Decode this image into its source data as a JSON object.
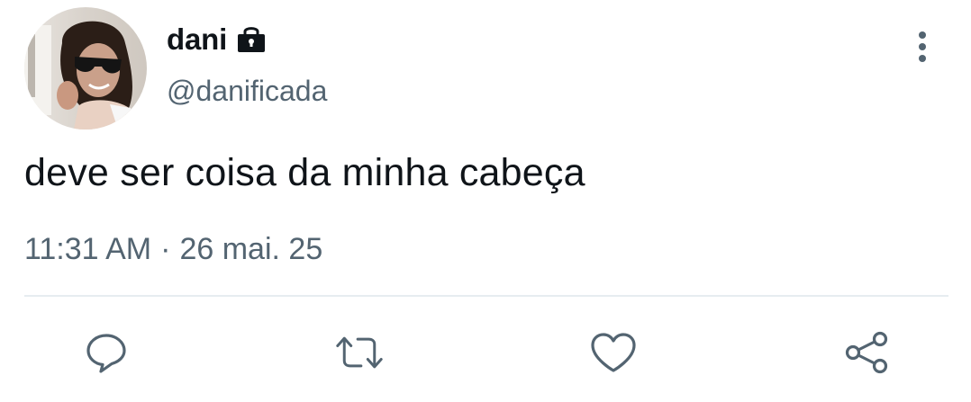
{
  "user": {
    "display_name": "dani",
    "handle": "@danificada",
    "avatar": "avatar-photo",
    "lock_icon": "lock-icon"
  },
  "tweet": {
    "text": "deve ser coisa da minha cabeça",
    "time": "11:31 AM",
    "separator": "·",
    "date": "26 mai. 25"
  },
  "actions": [
    {
      "name": "reply",
      "icon": "reply-icon"
    },
    {
      "name": "retweet",
      "icon": "retweet-icon"
    },
    {
      "name": "like",
      "icon": "heart-icon"
    },
    {
      "name": "share",
      "icon": "share-icon"
    }
  ],
  "menu": {
    "icon": "more-vertical-icon"
  },
  "colors": {
    "primary_text": "#0f1419",
    "secondary_text": "#536471",
    "icon": "#536471",
    "divider": "#e6ecf0",
    "background": "#ffffff"
  }
}
